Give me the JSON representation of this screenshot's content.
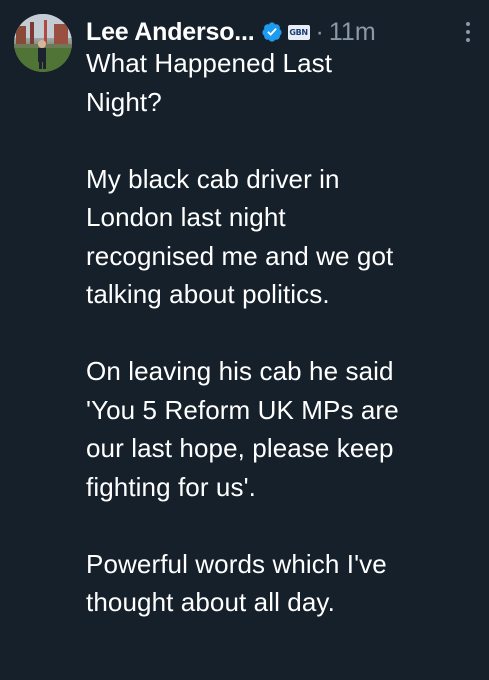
{
  "author": {
    "display_name": "Lee Anderso...",
    "verified_icon": "verified-badge-icon",
    "affiliation_badge": "GBN",
    "separator": "·",
    "time": "11m"
  },
  "post": {
    "paragraphs": [
      [
        "What Happened Last",
        "Night?"
      ],
      [
        "My black cab driver in",
        "London last night",
        "recognised me and we got",
        "talking about politics."
      ],
      [
        "On leaving his cab he said",
        "'You 5 Reform UK MPs are",
        "our last hope, please keep",
        "fighting for us'."
      ],
      [
        "Powerful words which I've",
        "thought about all day."
      ]
    ]
  },
  "colors": {
    "background": "#15202b",
    "text": "#ffffff",
    "muted": "#8b98a5",
    "verified": "#1d9bf0"
  }
}
